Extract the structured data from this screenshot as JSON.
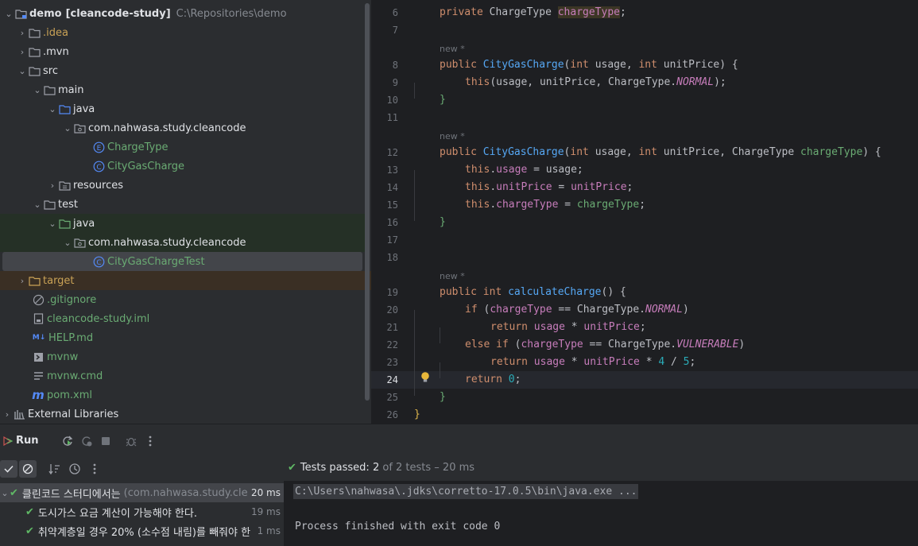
{
  "project_tree": {
    "root": {
      "name": "demo",
      "module": "[cleancode-study]",
      "path": "C:\\Repositories\\demo"
    },
    "items": [
      {
        "label": ".idea"
      },
      {
        "label": ".mvn"
      },
      {
        "label": "src"
      },
      {
        "label": "main"
      },
      {
        "label": "java"
      },
      {
        "label": "com.nahwasa.study.cleancode"
      },
      {
        "label": "ChargeType"
      },
      {
        "label": "CityGasCharge"
      },
      {
        "label": "resources"
      },
      {
        "label": "test"
      },
      {
        "label": "java"
      },
      {
        "label": "com.nahwasa.study.cleancode"
      },
      {
        "label": "CityGasChargeTest"
      },
      {
        "label": "target"
      },
      {
        "label": ".gitignore"
      },
      {
        "label": "cleancode-study.iml"
      },
      {
        "label": "HELP.md"
      },
      {
        "label": "mvnw"
      },
      {
        "label": "mvnw.cmd"
      },
      {
        "label": "pom.xml"
      },
      {
        "label": "External Libraries"
      }
    ],
    "icon_letters": {
      "enum": "E",
      "class": "C",
      "markdown": "M↓",
      "maven": "m"
    }
  },
  "editor": {
    "usage_hint": "new *",
    "line_numbers": [
      "6",
      "7",
      "8",
      "9",
      "10",
      "11",
      "12",
      "13",
      "14",
      "15",
      "16",
      "17",
      "18",
      "19",
      "20",
      "21",
      "22",
      "23",
      "24",
      "25",
      "26"
    ],
    "current_line": "24",
    "code": {
      "l6": [
        "private ",
        "ChargeType ",
        "chargeType",
        ";"
      ],
      "l8": [
        "public ",
        "CityGasCharge",
        "(",
        "int ",
        "usage",
        ", ",
        "int ",
        "unitPrice",
        ") {"
      ],
      "l9": [
        "this",
        "(",
        "usage",
        ", ",
        "unitPrice",
        ", ChargeType.",
        "NORMAL",
        ");"
      ],
      "l10": [
        "}"
      ],
      "l12": [
        "public ",
        "CityGasCharge",
        "(",
        "int ",
        "usage",
        ", ",
        "int ",
        "unitPrice",
        ", ChargeType ",
        "chargeType",
        ") {"
      ],
      "l13": [
        "this",
        ".",
        "usage",
        " = ",
        "usage",
        ";"
      ],
      "l14": [
        "this",
        ".",
        "unitPrice",
        " = ",
        "unitPrice",
        ";"
      ],
      "l15": [
        "this",
        ".",
        "chargeType",
        " = ",
        "chargeType",
        ";"
      ],
      "l16": [
        "}"
      ],
      "l19": [
        "public ",
        "int ",
        "calculateCharge",
        "() {"
      ],
      "l20": [
        "if ",
        "(",
        "chargeType",
        " == ChargeType.",
        "NORMAL",
        ")"
      ],
      "l21": [
        "return ",
        "usage",
        " * ",
        "unitPrice",
        ";"
      ],
      "l22": [
        "else if ",
        "(",
        "chargeType",
        " == ChargeType.",
        "VULNERABLE",
        ")"
      ],
      "l23": [
        "return ",
        "usage",
        " * ",
        "unitPrice",
        " * ",
        "4",
        " / ",
        "5",
        ";"
      ],
      "l24": [
        "return ",
        "0",
        ";"
      ],
      "l25": [
        "}"
      ],
      "l26": [
        "}"
      ]
    }
  },
  "run_panel": {
    "title": "Run",
    "status": {
      "prefix": "Tests passed: ",
      "passed": "2",
      "suffix": " of 2 tests – 20 ms"
    },
    "tests": [
      {
        "name": "클린코드 스터디에서는",
        "class": "(com.nahwasa.study.cle",
        "time": "20 ms"
      },
      {
        "name": "도시가스 요금 계산이 가능해야 한다.",
        "time": "19 ms"
      },
      {
        "name": "취약계층일 경우 20% (소수점 내림)를 빼줘야 한",
        "time": "1 ms"
      }
    ],
    "console": {
      "command": "C:\\Users\\nahwasa\\.jdks\\corretto-17.0.5\\bin\\java.exe ...",
      "exit": "Process finished with exit code 0"
    }
  },
  "colors": {
    "keyword": "#cf8e6d",
    "method": "#56a8f5",
    "field": "#c77dbb",
    "number": "#2aacb8",
    "pass_green": "#5fb865",
    "panel_bg": "#2b2d30",
    "editor_bg": "#1e1f22"
  }
}
